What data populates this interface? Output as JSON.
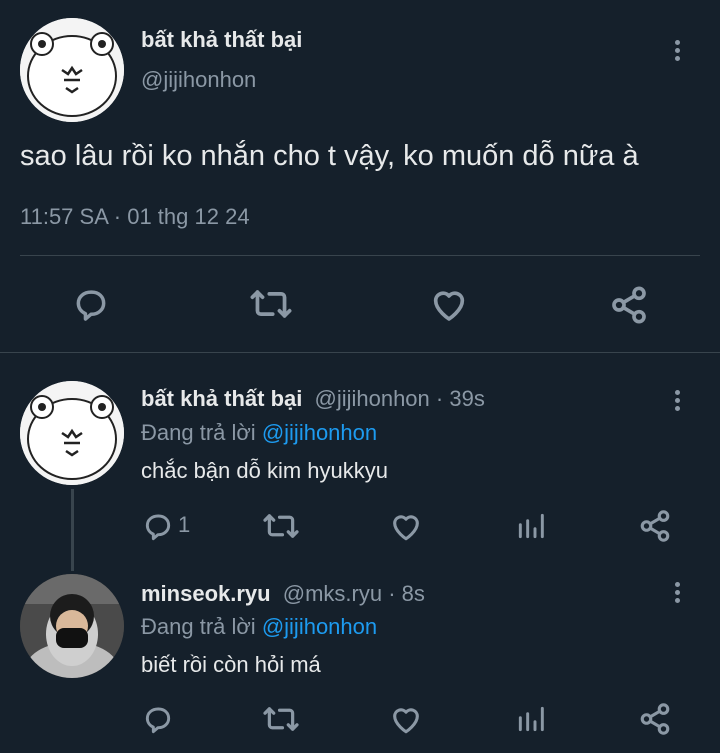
{
  "main_tweet": {
    "display_name": "bất khả thất bại",
    "handle": "@jijihonhon",
    "text": "sao lâu rồi ko nhắn cho t vậy, ko muốn dỗ nữa à",
    "timestamp": "11:57 SA · 01 thg 12 24",
    "actions": [
      "reply-icon",
      "retweet-icon",
      "like-icon",
      "share-icon"
    ]
  },
  "replies": [
    {
      "display_name": "bất khả thất bại",
      "handle": "@jijihonhon",
      "time": "· 39s",
      "replying_prefix": "Đang trả lời",
      "replying_to": "@jijihonhon",
      "text": "chắc bận dỗ kim hyukkyu",
      "reply_count": "1"
    },
    {
      "display_name": "minseok.ryu",
      "handle": "@mks.ryu",
      "time": "· 8s",
      "replying_prefix": "Đang trả lời",
      "replying_to": "@jijihonhon",
      "text": "biết rồi còn hỏi má",
      "reply_count": ""
    }
  ],
  "colors": {
    "background": "#15202b",
    "text": "#e7e9ea",
    "muted": "#8b98a5",
    "link": "#1d9bf0",
    "divider": "#38444d"
  }
}
